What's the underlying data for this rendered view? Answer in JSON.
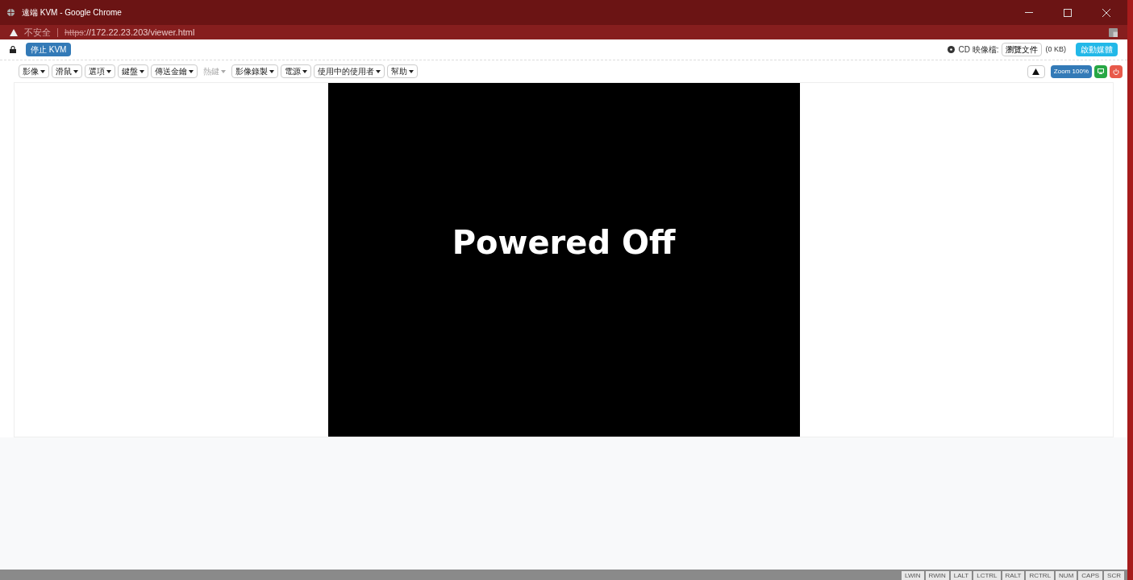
{
  "window": {
    "title": "遠端 KVM - Google Chrome"
  },
  "address_bar": {
    "security": "不安全",
    "scheme": "https",
    "rest": "://172.22.23.203/viewer.html"
  },
  "toolbar": {
    "stop_button": "停止 KVM",
    "cd_label": "CD 映像檔:",
    "browse_button": "瀏覽文件",
    "file_size": "(0 KB)",
    "start_button": "啟動媒體"
  },
  "menus": [
    {
      "label": "影像",
      "disabled": false
    },
    {
      "label": "滑鼠",
      "disabled": false
    },
    {
      "label": "選項",
      "disabled": false
    },
    {
      "label": "鍵盤",
      "disabled": false
    },
    {
      "label": "傳送金鑰",
      "disabled": false
    },
    {
      "label": "熱鍵",
      "disabled": true
    },
    {
      "label": "影像錄製",
      "disabled": false
    },
    {
      "label": "電源",
      "disabled": false
    },
    {
      "label": "使用中的使用者",
      "disabled": false
    },
    {
      "label": "幫助",
      "disabled": false
    }
  ],
  "zoom_button": "Zoom 100%",
  "screen": {
    "message": "Powered Off"
  },
  "status_keys": [
    "LWIN",
    "RWIN",
    "LALT",
    "LCTRL",
    "RALT",
    "RCTRL",
    "NUM",
    "CAPS",
    "SCR"
  ]
}
